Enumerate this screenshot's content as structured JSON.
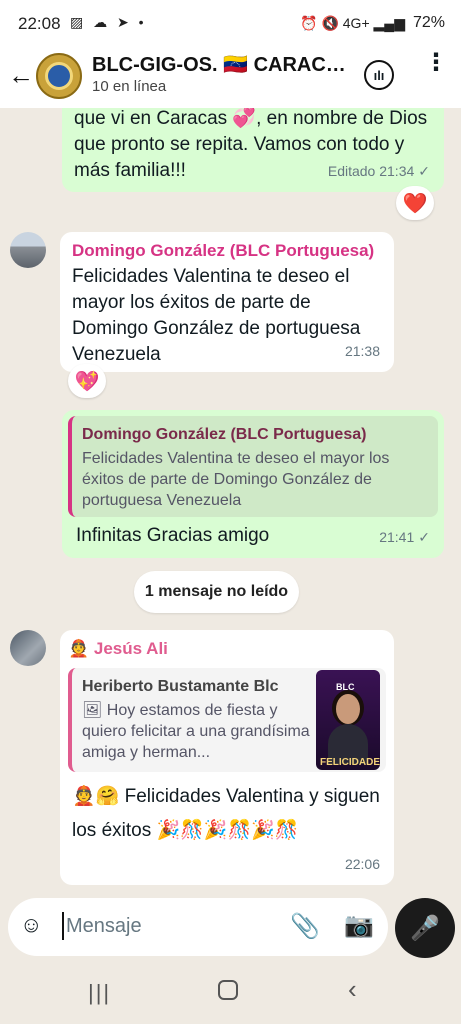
{
  "status": {
    "time": "22:08",
    "left_icons": "▨ ☁ ➤ •",
    "right_icons": "⏰ 🔇 4G+ ▂▄▆",
    "battery": "72%"
  },
  "header": {
    "title": "BLC-GIG-OS. 🇻🇪 CARACA...",
    "subtitle": "10 en línea"
  },
  "messages": [
    {
      "text": "que vi en Caracas 💞, en nombre de Dios que pronto se repita. Vamos con todo y más familia!!!",
      "meta": "Editado 21:34",
      "reaction": "❤️"
    },
    {
      "sender": "Domingo González (BLC Portuguesa)",
      "text": "Felicidades Valentina te deseo el mayor los éxitos de parte de Domingo González de portuguesa Venezuela",
      "meta": "21:38",
      "reaction": "💖"
    },
    {
      "quote_sender": "Domingo González (BLC Portuguesa)",
      "quote_text": "Felicidades Valentina te deseo el mayor los éxitos de parte de Domingo González de portuguesa Venezuela",
      "text": "Infinitas Gracias amigo",
      "meta": "21:41"
    },
    {
      "sender": "👲 Jesús Ali",
      "quote_sender": "Heriberto Bustamante Blc",
      "quote_text": "🖼 Hoy estamos de fiesta y quiero felicitar a una grandísima amiga y herman...",
      "thumb_logo": "BLC",
      "thumb_caption": "FELICIDADES",
      "text": "👲🤗 Felicidades Valentina y siguen los éxitos 🎉🎊🎉🎊🎉🎊",
      "meta": "22:06"
    }
  ],
  "unread_divider": "1 mensaje no leído",
  "input": {
    "placeholder": "Mensaje"
  },
  "icons": {
    "back": "←",
    "voice_chat": "ılı",
    "more": "⋮",
    "sticker": "☺",
    "attach": "📎",
    "camera": "📷",
    "mic": "🎤",
    "nav_recent": "|||",
    "nav_back": "‹",
    "tick": "✓"
  }
}
